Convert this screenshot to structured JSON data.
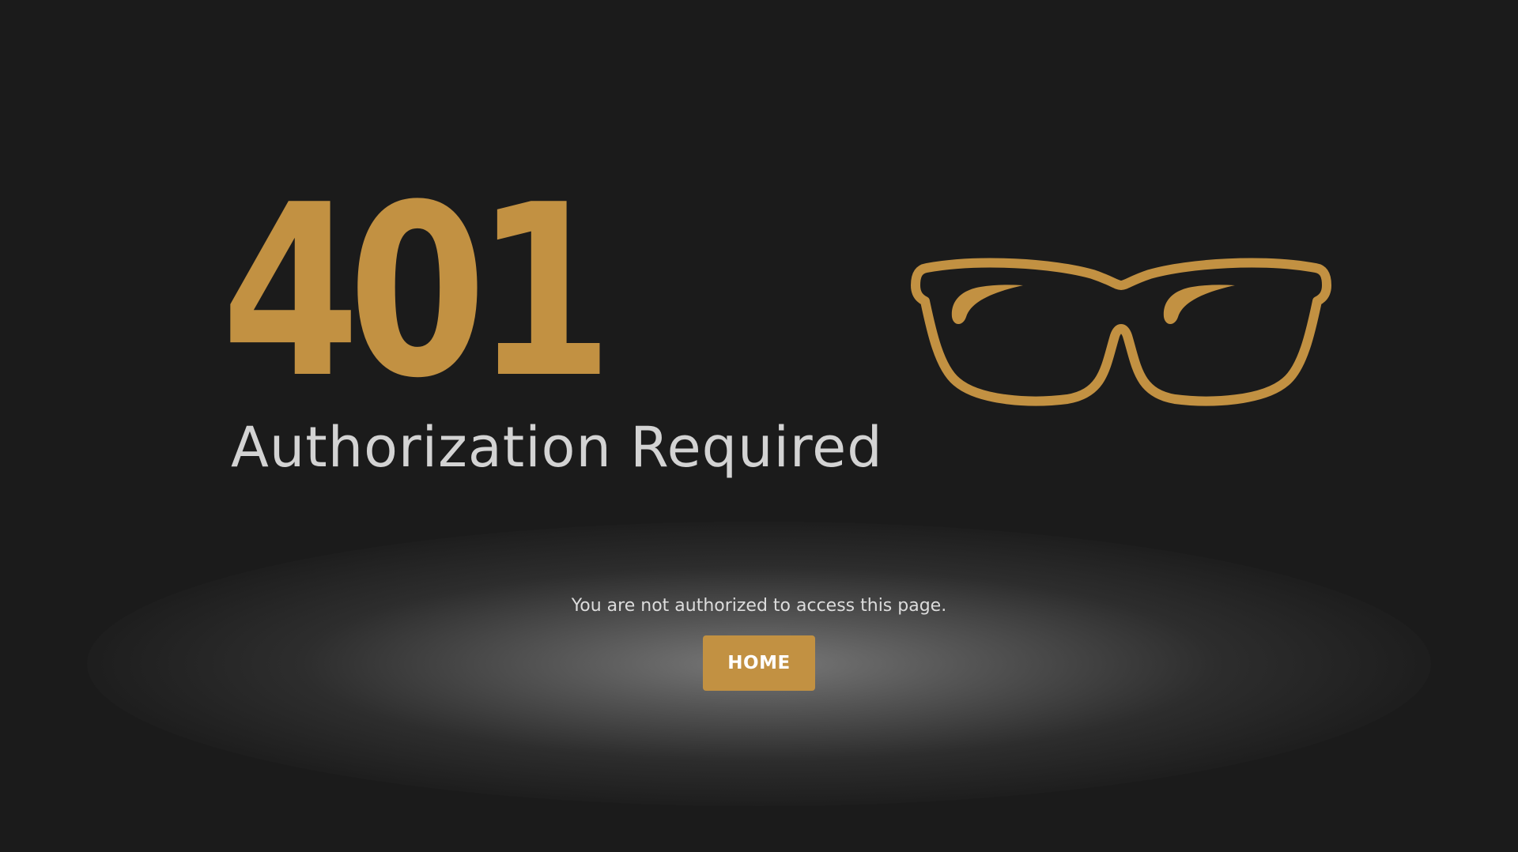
{
  "error": {
    "code": "401",
    "title": "Authorization Required",
    "message": "You are not authorized to access this page."
  },
  "actions": {
    "home_label": "HOME"
  },
  "icons": {
    "illustration": "eyeglasses-icon"
  },
  "colors": {
    "background": "#1b1b1b",
    "accent": "#c29142",
    "title_text": "#d3d3d3",
    "body_text": "#dcdcdc",
    "button_text": "#ffffff"
  }
}
